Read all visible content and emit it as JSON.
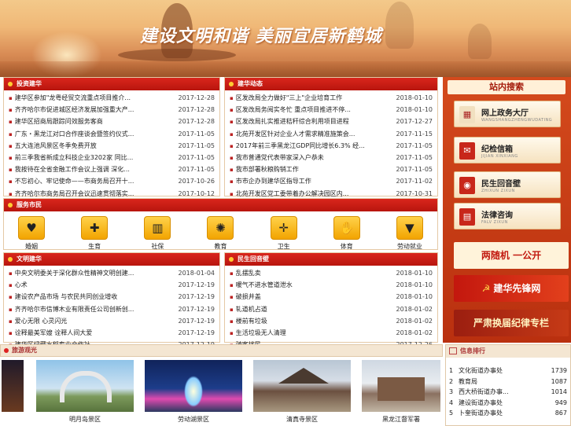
{
  "banner": {
    "slogan": "建设文明和谐  美丽宜居新鹤城"
  },
  "investment": {
    "title": "投资建华",
    "items": [
      {
        "title": "建华区参加\"龙粤经贸交流重点项目推介...",
        "date": "2017-12-28"
      },
      {
        "title": "齐齐哈尔市促进城区经济发展加强重大产...",
        "date": "2017-12-28"
      },
      {
        "title": "建华区招商局跟踪问效服务客商",
        "date": "2017-12-28"
      },
      {
        "title": "广东・黑龙江对口合作座谈会暨签约仪式...",
        "date": "2017-11-05"
      },
      {
        "title": "五大连池风景区冬季免费开放",
        "date": "2017-11-05"
      },
      {
        "title": "前三季我省新成立科技企业3202家 同比...",
        "date": "2017-11-05"
      },
      {
        "title": "我按待在全省金融工作会议上强调 深化...",
        "date": "2017-11-05"
      },
      {
        "title": "不忘初心、牢记使命——市商务局召开十...",
        "date": "2017-10-26"
      },
      {
        "title": "齐齐哈尔市商务局召开会议迅速贯彻落实...",
        "date": "2017-10-12"
      }
    ]
  },
  "dynamics": {
    "title": "建华动态",
    "items": [
      {
        "title": "区发改局全力做好\"三上\"企业培育工作",
        "date": "2018-01-10"
      },
      {
        "title": "区发改局务阅实冬忙 重点项目推进不停...",
        "date": "2018-01-10"
      },
      {
        "title": "区发改局扎实推进秸秆综合利用项目进程",
        "date": "2017-12-27"
      },
      {
        "title": "北苑开发区针对企业人才需求精准施策会...",
        "date": "2017-11-15"
      },
      {
        "title": "2017年前三季黑龙江GDP同比增长6.3% 经...",
        "date": "2017-11-05"
      },
      {
        "title": "我市普通党代表带家深入户恭未",
        "date": "2017-11-05"
      },
      {
        "title": "我市部署秋粮购销工作",
        "date": "2017-11-05"
      },
      {
        "title": "市市企办到建华区指导工作",
        "date": "2017-11-02"
      },
      {
        "title": "北苑开发区党工委带着办公解决园区内...",
        "date": "2017-10-31"
      }
    ]
  },
  "services": {
    "title": "服务市民",
    "items": [
      {
        "label": "婚姻",
        "icon": "♥"
      },
      {
        "label": "生育",
        "icon": "✚"
      },
      {
        "label": "社保",
        "icon": "▥"
      },
      {
        "label": "教育",
        "icon": "✺"
      },
      {
        "label": "卫生",
        "icon": "✛"
      },
      {
        "label": "体育",
        "icon": "✋"
      },
      {
        "label": "劳动就业",
        "icon": "▼"
      }
    ]
  },
  "civilization": {
    "title": "文明建华",
    "items": [
      {
        "title": "中央文明委关于深化群众性精神文明创建...",
        "date": "2018-01-04"
      },
      {
        "title": "心术",
        "date": "2017-12-19"
      },
      {
        "title": "建设农产品市场 与农民共同创业增收",
        "date": "2017-12-19"
      },
      {
        "title": "齐齐哈尔市信博木业有限责任公司创新创...",
        "date": "2017-12-19"
      },
      {
        "title": "爱心无限 心灵闪光",
        "date": "2017-12-19"
      },
      {
        "title": "诠释最美军嫂 诠释人间大爱",
        "date": "2017-12-19"
      },
      {
        "title": "建华区绿藏水稻专业合作社",
        "date": "2017-12-19"
      }
    ]
  },
  "livelihood": {
    "title": "民生回音壁",
    "items": [
      {
        "title": "乱摆乱卖",
        "date": "2018-01-10"
      },
      {
        "title": "暖气不进水管道泄水",
        "date": "2018-01-10"
      },
      {
        "title": "破损井盖",
        "date": "2018-01-10"
      },
      {
        "title": "轧道机占道",
        "date": "2018-01-02"
      },
      {
        "title": "楼前有垃圾",
        "date": "2018-01-02"
      },
      {
        "title": "生活垃圾无人清理",
        "date": "2018-01-02"
      },
      {
        "title": "骑客扰民",
        "date": "2017-12-26"
      }
    ]
  },
  "sidebar": {
    "title": "站内搜索",
    "buttons": [
      {
        "main": "网上政务大厅",
        "sub": "WANGSHANGZHENGWUDATING"
      },
      {
        "main": "纪检信箱",
        "sub": "JIJIAN XINXIANG"
      },
      {
        "main": "民生回音壁",
        "sub": "ZHIXUN ZIXUN"
      },
      {
        "main": "法律咨询",
        "sub": "FALV ZIXUN"
      }
    ],
    "banners": [
      "两随机 一公开",
      "建华先锋网",
      "严肃换届纪律专栏"
    ]
  },
  "tourism": {
    "title": "旅游观光",
    "photos": [
      "明月岛景区",
      "劳动湖景区",
      "清真寺景区",
      "黑龙江督军署"
    ]
  },
  "ranking": {
    "title": "信息排行",
    "items": [
      {
        "n": "1",
        "name": "文化街道办事处",
        "count": "1739"
      },
      {
        "n": "2",
        "name": "教育局",
        "count": "1087"
      },
      {
        "n": "3",
        "name": "西大桥街道办事...",
        "count": "1014"
      },
      {
        "n": "4",
        "name": "建设街道办事处",
        "count": "949"
      },
      {
        "n": "5",
        "name": "卜奎街道办事处",
        "count": "867"
      }
    ]
  },
  "colors": {
    "accent": "#c8271a",
    "sidebar": "#c63a16",
    "icon": "#f2a400"
  }
}
